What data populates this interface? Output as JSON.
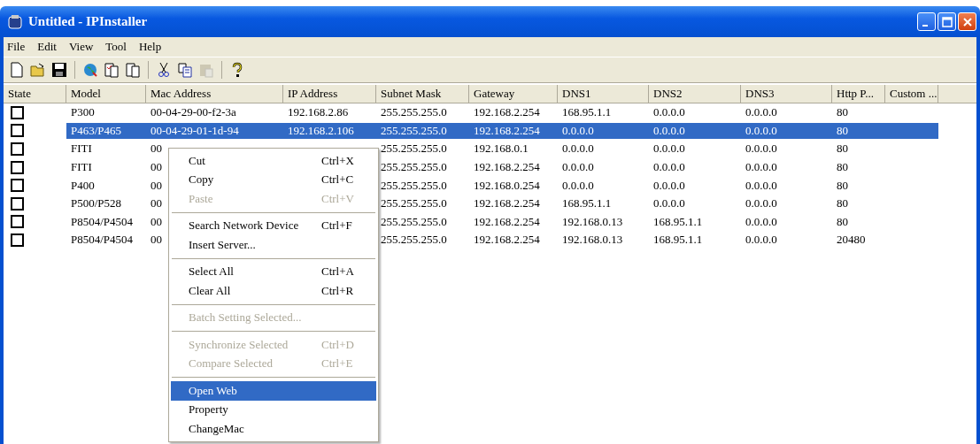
{
  "window": {
    "title": "Untitled - IPInstaller"
  },
  "menu_bar": [
    "File",
    "Edit",
    "View",
    "Tool",
    "Help"
  ],
  "toolbar": [
    {
      "kind": "button",
      "disabled": false
    },
    {
      "kind": "button",
      "disabled": false
    },
    {
      "kind": "button",
      "disabled": false
    },
    {
      "kind": "separator"
    },
    {
      "kind": "button",
      "disabled": false
    },
    {
      "kind": "button",
      "disabled": false
    },
    {
      "kind": "button",
      "disabled": false
    },
    {
      "kind": "separator"
    },
    {
      "kind": "button",
      "disabled": false
    },
    {
      "kind": "button",
      "disabled": false
    },
    {
      "kind": "button",
      "disabled": true
    },
    {
      "kind": "separator"
    },
    {
      "kind": "button",
      "disabled": false
    }
  ],
  "table": {
    "columns": [
      "State",
      "Model",
      "Mac Address",
      "IP Address",
      "Subnet Mask",
      "Gateway",
      "DNS1",
      "DNS2",
      "DNS3",
      "Http P...",
      "Custom ..."
    ],
    "rows": [
      {
        "selected": false,
        "cells": [
          {
            "checked": false
          },
          "P300",
          "00-04-29-00-f2-3a",
          "192.168.2.86",
          "255.255.255.0",
          "192.168.2.254",
          "168.95.1.1",
          "0.0.0.0",
          "0.0.0.0",
          "80"
        ]
      },
      {
        "selected": true,
        "cells": [
          {
            "checked": false
          },
          "P463/P465",
          "00-04-29-01-1d-94",
          "192.168.2.106",
          "255.255.255.0",
          "192.168.2.254",
          "0.0.0.0",
          "0.0.0.0",
          "0.0.0.0",
          "80"
        ]
      },
      {
        "selected": false,
        "cells": [
          {
            "checked": false
          },
          "FITI",
          "00",
          null,
          "255.255.255.0",
          "192.168.0.1",
          "0.0.0.0",
          "0.0.0.0",
          "0.0.0.0",
          "80"
        ]
      },
      {
        "selected": false,
        "cells": [
          {
            "checked": false
          },
          "FITI",
          "00",
          null,
          "255.255.255.0",
          "192.168.2.254",
          "0.0.0.0",
          "0.0.0.0",
          "0.0.0.0",
          "80"
        ]
      },
      {
        "selected": false,
        "cells": [
          {
            "checked": false
          },
          "P400",
          "00",
          null,
          "255.255.255.0",
          "192.168.0.254",
          "0.0.0.0",
          "0.0.0.0",
          "0.0.0.0",
          "80"
        ]
      },
      {
        "selected": false,
        "cells": [
          {
            "checked": false
          },
          "P500/P528",
          "00",
          null,
          "255.255.255.0",
          "192.168.2.254",
          "168.95.1.1",
          "0.0.0.0",
          "0.0.0.0",
          "80"
        ]
      },
      {
        "selected": false,
        "cells": [
          {
            "checked": false
          },
          "P8504/P4504",
          "00",
          null,
          "255.255.255.0",
          "192.168.2.254",
          "192.168.0.13",
          "168.95.1.1",
          "0.0.0.0",
          "80"
        ]
      },
      {
        "selected": false,
        "cells": [
          {
            "checked": false
          },
          "P8504/P4504",
          "00",
          null,
          "255.255.255.0",
          "192.168.2.254",
          "192.168.0.13",
          "168.95.1.1",
          "0.0.0.0",
          "20480"
        ]
      }
    ]
  },
  "context_menu": {
    "items": [
      {
        "kind": "item",
        "label": "Cut",
        "shortcut": "Ctrl+X",
        "disabled": false,
        "selected": false
      },
      {
        "kind": "item",
        "label": "Copy",
        "shortcut": "Ctrl+C",
        "disabled": false,
        "selected": false
      },
      {
        "kind": "item",
        "label": "Paste",
        "shortcut": "Ctrl+V",
        "disabled": true,
        "selected": false
      },
      {
        "kind": "separator"
      },
      {
        "kind": "item",
        "label": "Search Network Device",
        "shortcut": "Ctrl+F",
        "disabled": false,
        "selected": false
      },
      {
        "kind": "item",
        "label": "Insert Server...",
        "disabled": false,
        "selected": false
      },
      {
        "kind": "separator"
      },
      {
        "kind": "item",
        "label": "Select All",
        "shortcut": "Ctrl+A",
        "disabled": false,
        "selected": false
      },
      {
        "kind": "item",
        "label": "Clear All",
        "shortcut": "Ctrl+R",
        "disabled": false,
        "selected": false
      },
      {
        "kind": "separator"
      },
      {
        "kind": "item",
        "label": "Batch Setting Selected...",
        "disabled": true,
        "selected": false
      },
      {
        "kind": "separator"
      },
      {
        "kind": "item",
        "label": "Synchronize Selected",
        "shortcut": "Ctrl+D",
        "disabled": true,
        "selected": false
      },
      {
        "kind": "item",
        "label": "Compare Selected",
        "shortcut": "Ctrl+E",
        "disabled": true,
        "selected": false
      },
      {
        "kind": "separator"
      },
      {
        "kind": "item",
        "label": "Open Web",
        "disabled": false,
        "selected": true
      },
      {
        "kind": "item",
        "label": "Property",
        "disabled": false,
        "selected": false
      },
      {
        "kind": "item",
        "label": "ChangeMac",
        "disabled": false,
        "selected": false
      }
    ]
  }
}
